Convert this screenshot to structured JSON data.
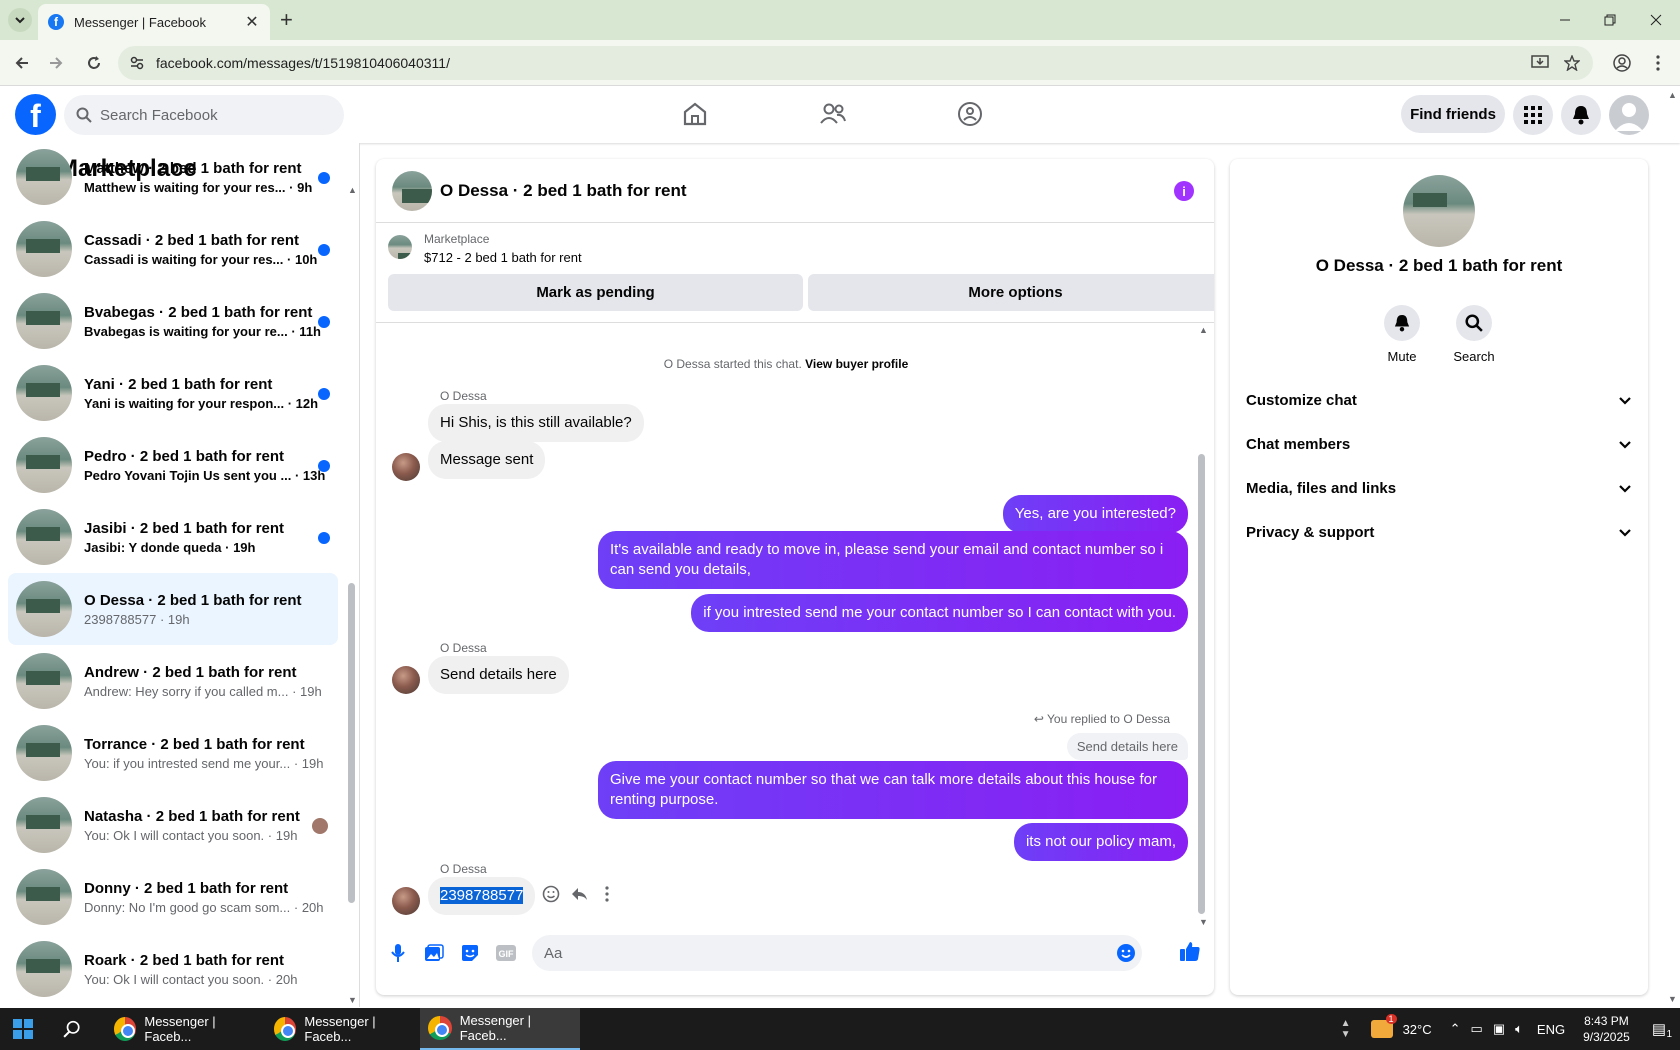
{
  "browser": {
    "tab_title": "Messenger | Facebook",
    "url": "facebook.com/messages/t/1519810406040311/"
  },
  "header": {
    "search_placeholder": "Search Facebook",
    "find_friends": "Find friends"
  },
  "sidebar": {
    "title": "Marketplace",
    "conversations": [
      {
        "name": "Matthew · 2 bed 1 bath for rent",
        "snippet": "Matthew is waiting for your res...",
        "time": "· 9h",
        "unread": true
      },
      {
        "name": "Cassadi · 2 bed 1 bath for rent",
        "snippet": "Cassadi is waiting for your res...",
        "time": "· 10h",
        "unread": true
      },
      {
        "name": "Bvabegas · 2 bed 1 bath for rent",
        "snippet": "Bvabegas is waiting for your re...",
        "time": "· 11h",
        "unread": true
      },
      {
        "name": "Yani · 2 bed 1 bath for rent",
        "snippet": "Yani is waiting for your respon...",
        "time": "· 12h",
        "unread": true
      },
      {
        "name": "Pedro · 2 bed 1 bath for rent",
        "snippet": "Pedro Yovani Tojin Us sent you ...",
        "time": "· 13h",
        "unread": true
      },
      {
        "name": "Jasibi · 2 bed 1 bath for rent",
        "snippet": "Jasibi: Y donde queda",
        "time": "· 19h",
        "unread": true
      },
      {
        "name": "O Dessa · 2 bed 1 bath for rent",
        "snippet": "2398788577",
        "time": "· 19h",
        "unread": false,
        "selected": true
      },
      {
        "name": "Andrew · 2 bed 1 bath for rent",
        "snippet": "Andrew: Hey sorry if you called m...",
        "time": "· 19h",
        "unread": false
      },
      {
        "name": "Torrance · 2 bed 1 bath for rent",
        "snippet": "You: if you intrested send me your...",
        "time": "· 19h",
        "unread": false
      },
      {
        "name": "Natasha · 2 bed 1 bath for rent",
        "snippet": "You: Ok I will contact you soon.",
        "time": "· 19h",
        "unread": false,
        "seen_avatar": true
      },
      {
        "name": "Donny · 2 bed 1 bath for rent",
        "snippet": "Donny: No I'm good go scam som...",
        "time": "· 20h",
        "unread": false
      },
      {
        "name": "Roark · 2 bed 1 bath for rent",
        "snippet": "You: Ok I will contact you soon.",
        "time": "· 20h",
        "unread": false
      }
    ]
  },
  "chat": {
    "title": "O Dessa · 2 bed 1 bath for rent",
    "listing_source": "Marketplace",
    "listing_price": "$712 - 2 bed 1 bath for rent",
    "mark_pending": "Mark as pending",
    "more_options": "More options",
    "started_text": "O Dessa started this chat.",
    "view_buyer": "View buyer profile",
    "sender_name": "O Dessa",
    "msg_in_1": "Hi Shis, is this still available?",
    "msg_in_2": "Message sent",
    "msg_out_1": "Yes, are you interested?",
    "msg_out_2": "It's available and ready to move in, please send your email and contact number so i can send you details,",
    "msg_out_3": "if you intrested send me your contact number so I can contact with you.",
    "msg_in_3": "Send details here",
    "replied_to": "You replied to O Dessa",
    "quoted": "Send details here",
    "msg_out_4": "Give me your contact number so that we can talk more details about this house for renting purpose.",
    "msg_out_5": "its not our policy mam,",
    "msg_in_4": "2398788577",
    "input_placeholder": "Aa"
  },
  "details": {
    "name": "O Dessa · 2 bed 1 bath for rent",
    "mute": "Mute",
    "search": "Search",
    "sections": [
      "Customize chat",
      "Chat members",
      "Media, files and links",
      "Privacy & support"
    ]
  },
  "taskbar": {
    "apps": [
      "Messenger | Faceb...",
      "Messenger | Faceb...",
      "Messenger | Faceb..."
    ],
    "temp": "32°C",
    "lang": "ENG",
    "time": "8:43 PM",
    "date": "9/3/2025",
    "notif_count": "1"
  },
  "colors": {
    "fb_blue": "#0866ff",
    "bubble_out": "#7a1cff",
    "selection": "#0a64d6"
  }
}
